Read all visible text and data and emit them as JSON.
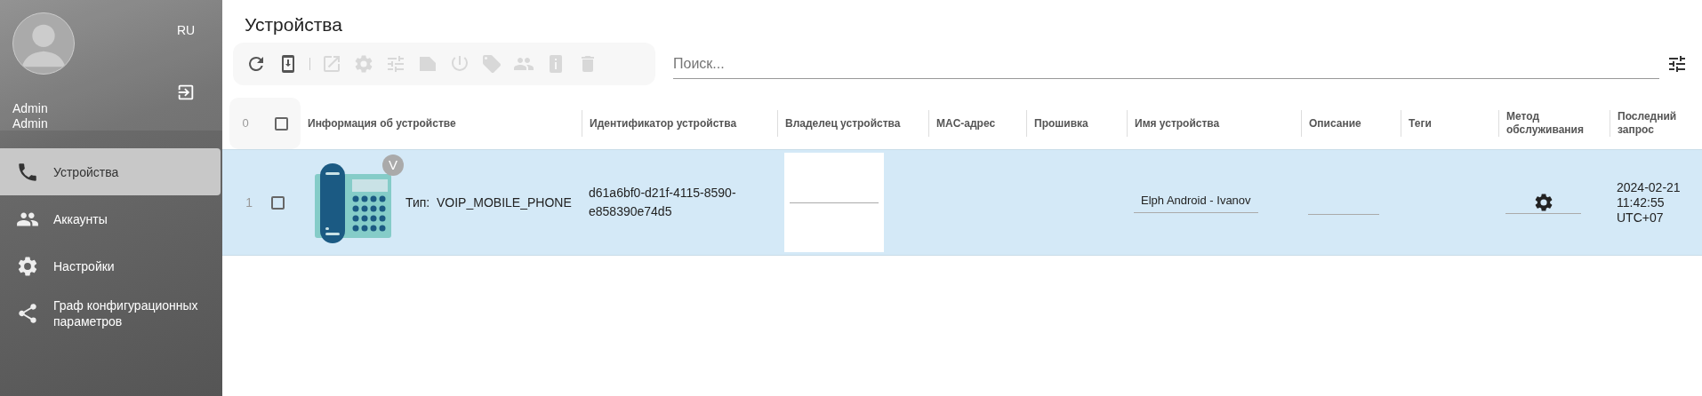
{
  "sidebar": {
    "language": "RU",
    "user_lines": [
      "Admin",
      "Admin"
    ],
    "items": [
      {
        "kind": "phone",
        "label": "Устройства",
        "selected": true
      },
      {
        "kind": "people",
        "label": "Аккаунты",
        "selected": false
      },
      {
        "kind": "gear",
        "label": "Настройки",
        "selected": false
      },
      {
        "kind": "share",
        "label": "Граф конфигурационных параметров",
        "selected": false
      }
    ]
  },
  "page_title": "Устройства",
  "toolbar": [
    {
      "kind": "refresh",
      "disabled": false
    },
    {
      "kind": "import",
      "disabled": false
    },
    {
      "kind": "separator"
    },
    {
      "kind": "open",
      "disabled": true
    },
    {
      "kind": "gear",
      "disabled": true
    },
    {
      "kind": "tune",
      "disabled": true
    },
    {
      "kind": "folder",
      "disabled": true
    },
    {
      "kind": "power",
      "disabled": true
    },
    {
      "kind": "tag",
      "disabled": true
    },
    {
      "kind": "people",
      "disabled": true
    },
    {
      "kind": "info",
      "disabled": true
    },
    {
      "kind": "trash",
      "disabled": true
    }
  ],
  "search": {
    "placeholder": "Поиск..."
  },
  "table": {
    "count": "0",
    "all_checked": false,
    "columns": [
      "Информация об устройстве",
      "Идентификатор устройства",
      "Владелец устройства",
      "MAC-адрес",
      "Прошивка",
      "Имя устройства",
      "Описание",
      "Теги",
      "Метод обслуживания",
      "Последний запрос"
    ],
    "rows": [
      {
        "index": "1",
        "checked": false,
        "selected": true,
        "badge": "V",
        "type_label": "Тип:",
        "type": "VOIP_MOBILE_PHONE",
        "identifier": "d61a6bf0-d21f-4115-8590-e858390e74d5",
        "device_name": "Elph Android - Ivanov",
        "last_request": [
          "2024-02-21",
          "11:42:55",
          "UTC+07"
        ]
      }
    ]
  }
}
